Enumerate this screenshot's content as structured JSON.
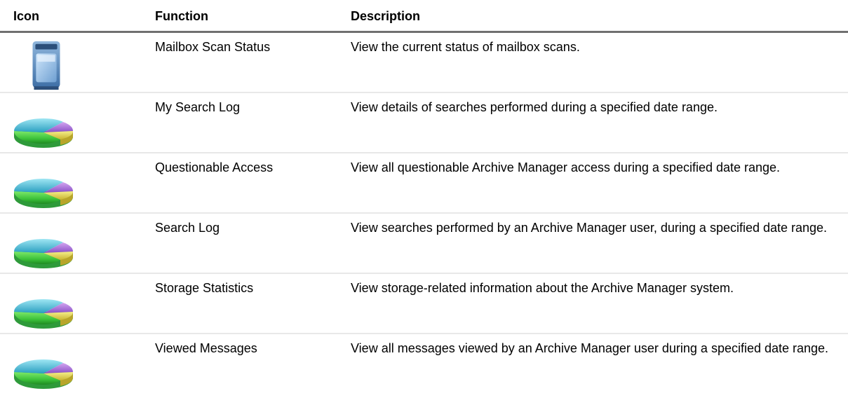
{
  "headers": {
    "icon": "Icon",
    "function": "Function",
    "description": "Description"
  },
  "rows": [
    {
      "icon": "mailbox-icon",
      "function": "Mailbox Scan Status",
      "description": "View the current status of mailbox scans."
    },
    {
      "icon": "pie-chart-icon",
      "function": "My Search Log",
      "description": "View details of searches performed during a specified date range."
    },
    {
      "icon": "pie-chart-icon",
      "function": "Questionable Access",
      "description": "View all questionable Archive Manager access during a specified date range."
    },
    {
      "icon": "pie-chart-icon",
      "function": "Search Log",
      "description": "View searches performed by an Archive Manager user, during a specified date range."
    },
    {
      "icon": "pie-chart-icon",
      "function": "Storage Statistics",
      "description": "View storage-related information about the Archive Manager system."
    },
    {
      "icon": "pie-chart-icon",
      "function": "Viewed Messages",
      "description": "View all messages viewed by an Archive Manager user during a specified date range."
    }
  ]
}
